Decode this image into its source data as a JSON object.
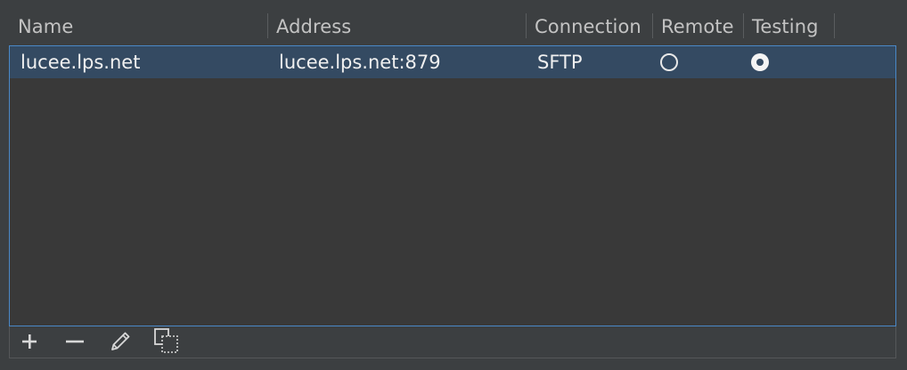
{
  "columns": {
    "name": "Name",
    "address": "Address",
    "connection": "Connection",
    "remote": "Remote",
    "testing": "Testing"
  },
  "rows": [
    {
      "name": "lucee.lps.net",
      "address": "lucee.lps.net:879",
      "connection": "SFTP",
      "remote": false,
      "testing": true,
      "selected": true
    }
  ],
  "toolbar": {
    "icons": [
      "add-icon",
      "remove-icon",
      "edit-icon",
      "copy-icon"
    ]
  },
  "colors": {
    "background": "#3c3f41",
    "selection": "#344a62",
    "focus_border": "#4a88c7",
    "text": "#f0f0f0",
    "header_text": "#c3c3c3"
  }
}
